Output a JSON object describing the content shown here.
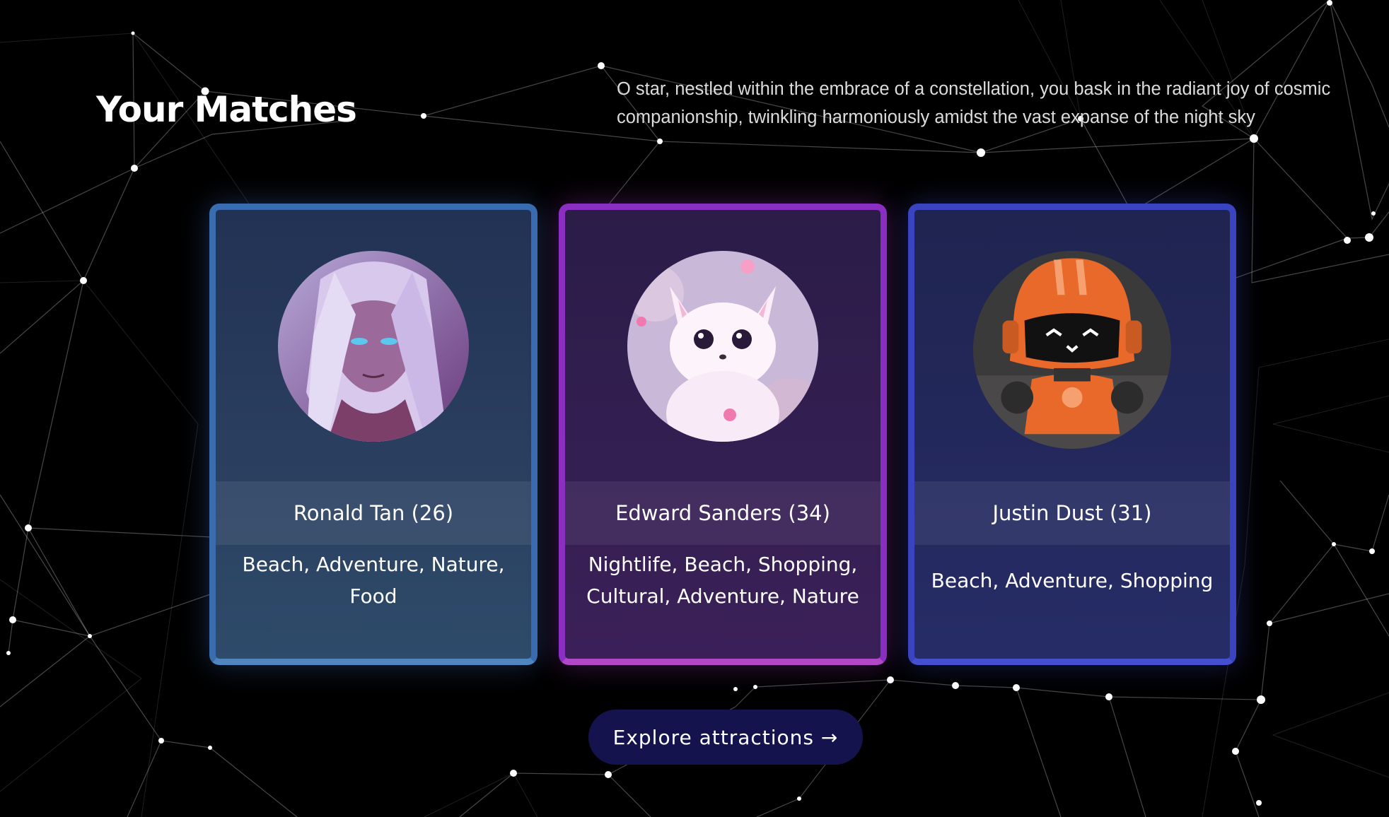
{
  "header": {
    "title": "Your Matches",
    "tagline": "O star, nestled within the embrace of a constellation, you bask in the radiant joy of cosmic companionship, twinkling harmoniously amidst the vast expanse of the night sky"
  },
  "matches": [
    {
      "name": "Ronald Tan (26)",
      "interests": "Beach, Adventure, Nature, Food",
      "avatar": "elf-warrior-portrait",
      "accent": "#3a6cb0"
    },
    {
      "name": "Edward Sanders (34)",
      "interests": "Nightlife, Beach, Shopping, Cultural, Adventure, Nature",
      "avatar": "white-fox-creature",
      "accent": "#8a2fc2"
    },
    {
      "name": "Justin Dust (31)",
      "interests": "Beach, Adventure, Shopping",
      "avatar": "orange-robot",
      "accent": "#3a44c0"
    }
  ],
  "cta": {
    "label": "Explore attractions →"
  }
}
